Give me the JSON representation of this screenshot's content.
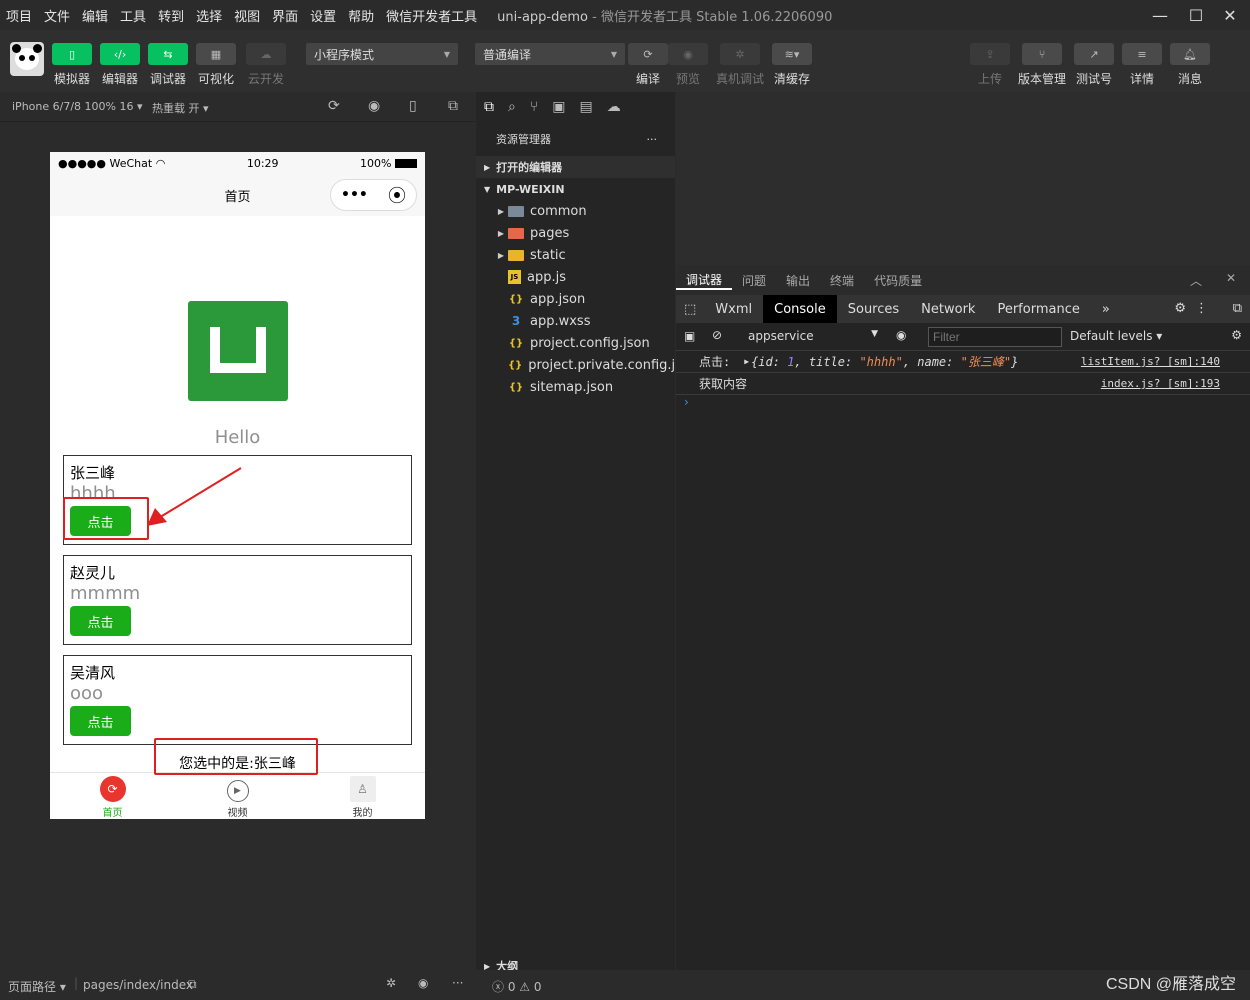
{
  "menubar": {
    "items": [
      "项目",
      "文件",
      "编辑",
      "工具",
      "转到",
      "选择",
      "视图",
      "界面",
      "设置",
      "帮助",
      "微信开发者工具"
    ],
    "app_title": "uni-app-demo",
    "app_subtitle": "- 微信开发者工具 Stable 1.06.2206090"
  },
  "toolbar": {
    "simulator": "模拟器",
    "editor": "编辑器",
    "debugger": "调试器",
    "visual": "可视化",
    "cloud": "云开发",
    "mode_select": "小程序模式",
    "compile_select": "普通编译",
    "compile": "编译",
    "preview": "预览",
    "remote_debug": "真机调试",
    "clear_cache": "清缓存",
    "upload": "上传",
    "version": "版本管理",
    "test": "测试号",
    "detail": "详情",
    "message": "消息"
  },
  "simbar": {
    "device": "iPhone 6/7/8 100% 16",
    "hotreload": "热重载 开"
  },
  "phone": {
    "carrier": "●●●●● WeChat",
    "time": "10:29",
    "battery": "100%",
    "nav_title": "首页",
    "hello": "Hello",
    "cards": [
      {
        "name": "张三峰",
        "desc": "hhhh",
        "button": "点击"
      },
      {
        "name": "赵灵儿",
        "desc": "mmmm",
        "button": "点击"
      },
      {
        "name": "吴清风",
        "desc": "ooo",
        "button": "点击"
      }
    ],
    "selected_text": "您选中的是:张三峰",
    "tabs": [
      {
        "label": "首页"
      },
      {
        "label": "视频"
      },
      {
        "label": "我的"
      }
    ]
  },
  "explorer": {
    "title": "资源管理器",
    "open_editors": "打开的编辑器",
    "project": "MP-WEIXIN",
    "files": [
      {
        "name": "common",
        "type": "folder"
      },
      {
        "name": "pages",
        "type": "folder"
      },
      {
        "name": "static",
        "type": "folder"
      },
      {
        "name": "app.js",
        "type": "js"
      },
      {
        "name": "app.json",
        "type": "json"
      },
      {
        "name": "app.wxss",
        "type": "css"
      },
      {
        "name": "project.config.json",
        "type": "json"
      },
      {
        "name": "project.private.config.js...",
        "type": "json"
      },
      {
        "name": "sitemap.json",
        "type": "json"
      }
    ],
    "outline": "大纲"
  },
  "devtools": {
    "top_tabs": [
      "调试器",
      "问题",
      "输出",
      "终端",
      "代码质量"
    ],
    "tabs": [
      "Wxml",
      "Console",
      "Sources",
      "Network",
      "Performance"
    ],
    "context": "appservice",
    "filter_placeholder": "Filter",
    "levels": "Default levels",
    "log1": {
      "label": "点击:",
      "obj_open": "{id: ",
      "id": "1",
      "mid1": ", title: ",
      "title": "\"hhhh\"",
      "mid2": ", name: ",
      "name": "\"张三峰\"",
      "close": "}",
      "src": "listItem.js? [sm]:140"
    },
    "log2": {
      "text": "获取内容",
      "src": "index.js? [sm]:193"
    }
  },
  "statusbar": {
    "path_label": "页面路径",
    "path": "pages/index/index",
    "errors": "0",
    "warnings": "0"
  },
  "watermark": "CSDN @雁落成空",
  "colors": {
    "accent_green": "#07c160",
    "button_green": "#1aad19",
    "highlight_red": "#e02020",
    "logo_green": "#2b9939"
  }
}
